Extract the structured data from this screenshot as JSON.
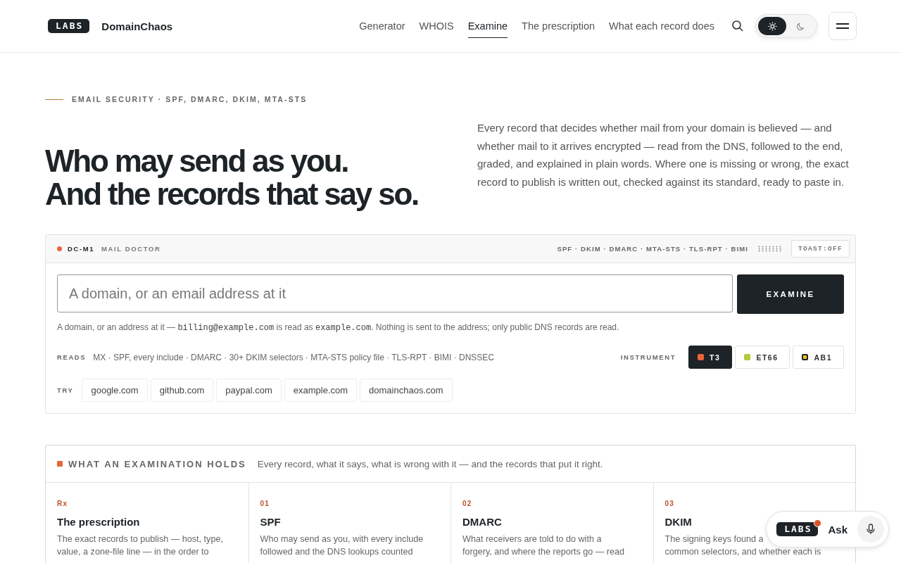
{
  "header": {
    "logo": "LABS",
    "brand": "DomainChaos",
    "nav": [
      {
        "label": "Generator",
        "selected": false
      },
      {
        "label": "WHOIS",
        "selected": false
      },
      {
        "label": "Examine",
        "selected": true
      },
      {
        "label": "The prescription",
        "selected": false
      },
      {
        "label": "What each record does",
        "selected": false
      }
    ],
    "theme": [
      {
        "kind": "light",
        "selected": true
      },
      {
        "kind": "dark",
        "selected": false
      }
    ]
  },
  "hero": {
    "eyebrow": "EMAIL SECURITY · SPF, DMARC, DKIM, MTA-STS",
    "title": [
      "Who may send as you.",
      "And the records that say so."
    ],
    "intro": "Every record that decides whether mail from your domain is believed — and whether mail to it arrives encrypted — read from the DNS, followed to the end, graded, and explained in plain words. Where one is missing or wrong, the exact record to publish is written out, checked against its standard, ready to paste in."
  },
  "panel": {
    "code": "DC-M1",
    "name": "MAIL DOCTOR",
    "checks": "SPF · DKIM · DMARC · MTA-STS · TLS-RPT · BIMI",
    "toast": "TOAST:OFF",
    "search": {
      "placeholder": "A domain, or an email address at it"
    },
    "button": "EXAMINE",
    "hint": [
      {
        "text": "A domain, or an address at it — ",
        "mono": false
      },
      {
        "text": "billing@example.com",
        "mono": true
      },
      {
        "text": " is read as ",
        "mono": false
      },
      {
        "text": "example.com",
        "mono": true
      },
      {
        "text": ". Nothing is sent to the address; only public DNS records are read.",
        "mono": false
      }
    ],
    "reads_label": "READS",
    "reads": "MX · SPF, every include · DMARC · 30+ DKIM selectors · MTA-STS policy file · TLS-RPT · BIMI · DNSSEC",
    "instrument_label": "INSTRUMENT",
    "instruments": [
      {
        "label": "T3",
        "selected": true,
        "color": "#e8663a"
      },
      {
        "label": "ET66",
        "selected": false,
        "color": "#b5c93a"
      },
      {
        "label": "AB1",
        "selected": false,
        "color": "#f2c318"
      }
    ],
    "try_label": "TRY",
    "examples": [
      "google.com",
      "github.com",
      "paypal.com",
      "example.com",
      "domainchaos.com"
    ]
  },
  "holds": {
    "title": "WHAT AN EXAMINATION HOLDS",
    "subtitle": "Every record, what it says, what is wrong with it — and the records that put it right.",
    "cards": [
      {
        "tag": "Rx",
        "title": "The prescription",
        "lines": [
          "The exact records to publish — host, type,",
          "value, a zone-file line — in the order to"
        ]
      },
      {
        "tag": "01",
        "title": "SPF",
        "lines": [
          "Who may send as you, with every include",
          "followed and the DNS lookups counted"
        ]
      },
      {
        "tag": "02",
        "title": "DMARC",
        "lines": [
          "What receivers are told to do with a",
          "forgery, and where the reports go — read"
        ]
      },
      {
        "tag": "03",
        "title": "DKIM",
        "lines": [
          "The signing keys found a",
          "common selectors, and whether each is"
        ]
      }
    ]
  },
  "ask": {
    "logo": "LABS",
    "label": "Ask",
    "notification": true
  }
}
